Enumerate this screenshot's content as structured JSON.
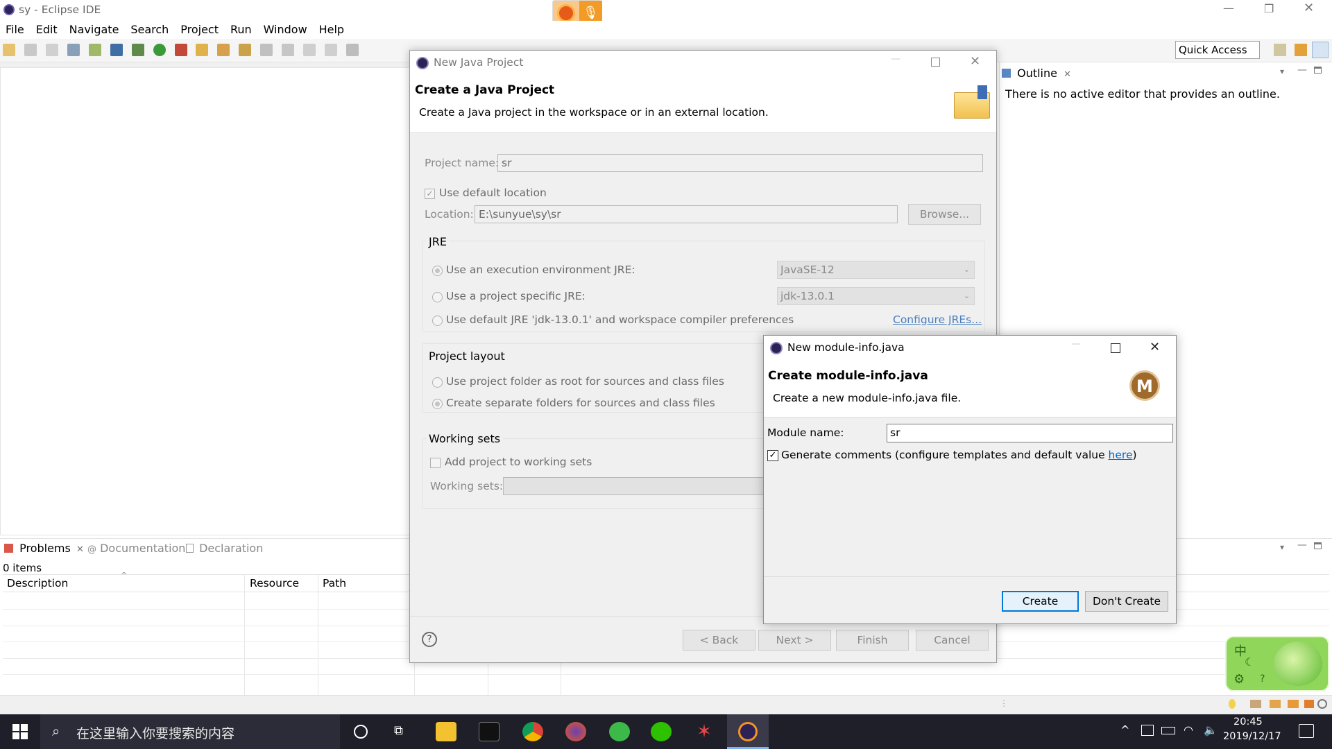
{
  "app": {
    "title": "sy - Eclipse IDE",
    "menu": [
      "File",
      "Edit",
      "Navigate",
      "Search",
      "Project",
      "Run",
      "Window",
      "Help"
    ],
    "quick_access": "Quick Access"
  },
  "outline": {
    "tab_label": "Outline",
    "message": "There is no active editor that provides an outline."
  },
  "bottom": {
    "tabs": [
      "Problems",
      "Documentation",
      "Declaration"
    ],
    "count": "0 items",
    "columns": [
      "Description",
      "Resource",
      "Path"
    ]
  },
  "java_dialog": {
    "title": "New Java Project",
    "heading": "Create a Java Project",
    "subtitle": "Create a Java project in the workspace or in an external location.",
    "project_name_label": "Project name:",
    "project_name_value": "sr",
    "use_default_location": "Use default location",
    "location_label": "Location:",
    "location_value": "E:\\sunyue\\sy\\sr",
    "browse": "Browse...",
    "jre_group": "JRE",
    "jre_options": [
      "Use an execution environment JRE:",
      "Use a project specific JRE:",
      "Use default JRE 'jdk-13.0.1' and workspace compiler preferences"
    ],
    "jre_env_value": "JavaSE-12",
    "jre_specific_value": "jdk-13.0.1",
    "configure_jres": "Configure JREs...",
    "layout_group": "Project layout",
    "layout_options": [
      "Use project folder as root for sources and class files",
      "Create separate folders for sources and class files"
    ],
    "working_sets_group": "Working sets",
    "add_to_working_sets": "Add project to working sets",
    "working_sets_label": "Working sets:",
    "buttons": [
      "< Back",
      "Next >",
      "Finish",
      "Cancel"
    ],
    "help": "?"
  },
  "module_dialog": {
    "title": "New module-info.java",
    "heading": "Create module-info.java",
    "subtitle": "Create a new module-info.java file.",
    "module_name_label": "Module name:",
    "module_name_value": "sr",
    "generate_comments_prefix": "Generate comments (configure templates and default value ",
    "generate_comments_link": "here",
    "generate_comments_suffix": ")",
    "checked": true,
    "icon_letter": "M",
    "create": "Create",
    "dont_create": "Don't Create"
  },
  "taskbar": {
    "search_placeholder": "在这里输入你要搜索的内容",
    "time": "20:45",
    "date": "2019/12/17",
    "ime_char": "中"
  },
  "colors": {
    "accent": "#0078d7",
    "taskbar": "#1f1f2a",
    "link": "#0066cc"
  }
}
